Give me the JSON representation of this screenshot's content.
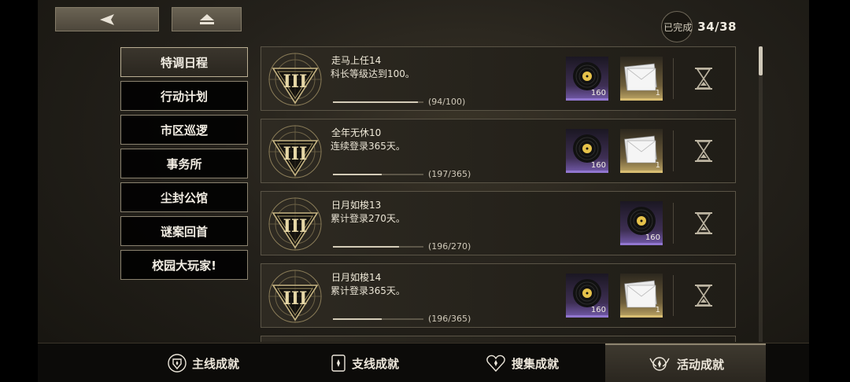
{
  "header": {
    "back_icon": "back-arrow-icon",
    "home_icon": "eject-home-icon",
    "completed_label": "已完成",
    "completed_count": "34/38"
  },
  "sidebar": {
    "items": [
      {
        "label": "特调日程",
        "active": true
      },
      {
        "label": "行动计划",
        "active": false
      },
      {
        "label": "市区巡逻",
        "active": false
      },
      {
        "label": "事务所",
        "active": false
      },
      {
        "label": "尘封公馆",
        "active": false
      },
      {
        "label": "谜案回首",
        "active": false
      },
      {
        "label": "校园大玩家!",
        "active": false
      }
    ]
  },
  "achievements": [
    {
      "title": "走马上任14",
      "desc": "科长等级达到100。",
      "progress_text": "(94/100)",
      "progress": 0.94,
      "rewards": [
        {
          "icon": "vinyl-record-icon",
          "rarity": "purple",
          "qty": "160"
        },
        {
          "icon": "card-envelope-icon",
          "rarity": "gold",
          "qty": "1"
        }
      ]
    },
    {
      "title": "全年无休10",
      "desc": "连续登录365天。",
      "progress_text": "(197/365)",
      "progress": 0.54,
      "rewards": [
        {
          "icon": "vinyl-record-icon",
          "rarity": "purple",
          "qty": "160"
        },
        {
          "icon": "card-envelope-icon",
          "rarity": "gold",
          "qty": "1"
        }
      ]
    },
    {
      "title": "日月如梭13",
      "desc": "累计登录270天。",
      "progress_text": "(196/270)",
      "progress": 0.73,
      "rewards": [
        {
          "icon": "vinyl-record-icon",
          "rarity": "purple",
          "qty": "160"
        }
      ]
    },
    {
      "title": "日月如梭14",
      "desc": "累计登录365天。",
      "progress_text": "(196/365)",
      "progress": 0.54,
      "rewards": [
        {
          "icon": "vinyl-record-icon",
          "rarity": "purple",
          "qty": "160"
        },
        {
          "icon": "card-envelope-icon",
          "rarity": "gold",
          "qty": "1"
        }
      ]
    }
  ],
  "tabs": [
    {
      "label": "主线成就",
      "icon": "shield-crest-icon",
      "active": false
    },
    {
      "label": "支线成就",
      "icon": "card-crest-icon",
      "active": false
    },
    {
      "label": "搜集成就",
      "icon": "heart-crest-icon",
      "active": false
    },
    {
      "label": "活动成就",
      "icon": "winged-crest-icon",
      "active": true
    }
  ],
  "colors": {
    "accent_gold": "#d8bd72",
    "accent_purple": "#9176cf"
  }
}
